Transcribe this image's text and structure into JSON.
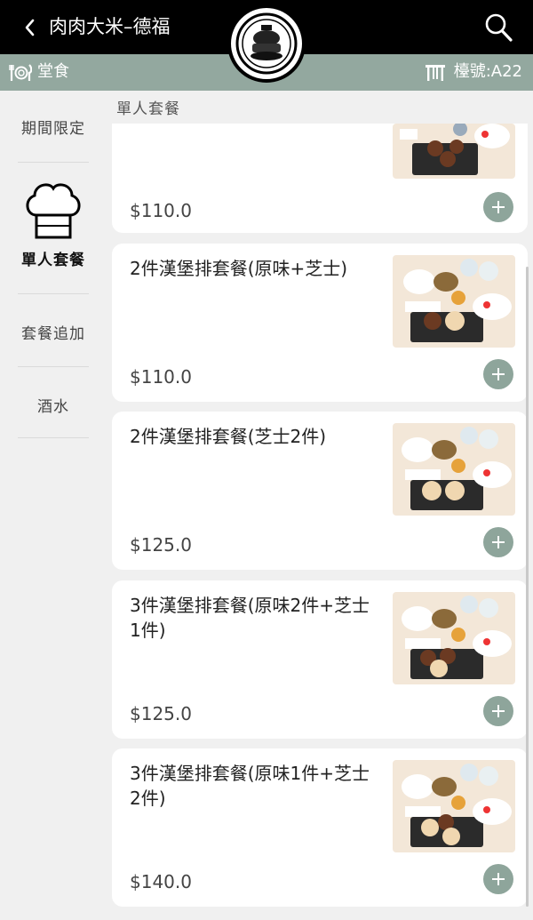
{
  "header": {
    "back_icon": "chevron-left-icon",
    "title": "肉肉大米–德福",
    "search_icon": "search-icon",
    "logo": "restaurant-logo"
  },
  "subbar": {
    "mode_icon": "dining-icon",
    "mode_label": "堂食",
    "table_icon": "table-icon",
    "table_label": "檯號:A22"
  },
  "sidebar": {
    "items": [
      {
        "label": "期間限定",
        "active": false
      },
      {
        "label": "單人套餐",
        "active": true,
        "icon": "chef-hat-icon"
      },
      {
        "label": "套餐追加",
        "active": false
      },
      {
        "label": "酒水",
        "active": false
      }
    ]
  },
  "section": {
    "title": "單人套餐"
  },
  "items": [
    {
      "name": "",
      "price": "$110.0"
    },
    {
      "name": "2件漢堡排套餐(原味+芝士)",
      "price": "$110.0"
    },
    {
      "name": "2件漢堡排套餐(芝士2件)",
      "price": "$125.0"
    },
    {
      "name": "3件漢堡排套餐(原味2件+芝士1件)",
      "price": "$125.0"
    },
    {
      "name": "3件漢堡排套餐(原味1件+芝士2件)",
      "price": "$140.0"
    }
  ],
  "colors": {
    "header_bg": "#000000",
    "subbar_bg": "#93a89f",
    "accent": "#8ea59b",
    "page_bg": "#f0f0f0"
  }
}
